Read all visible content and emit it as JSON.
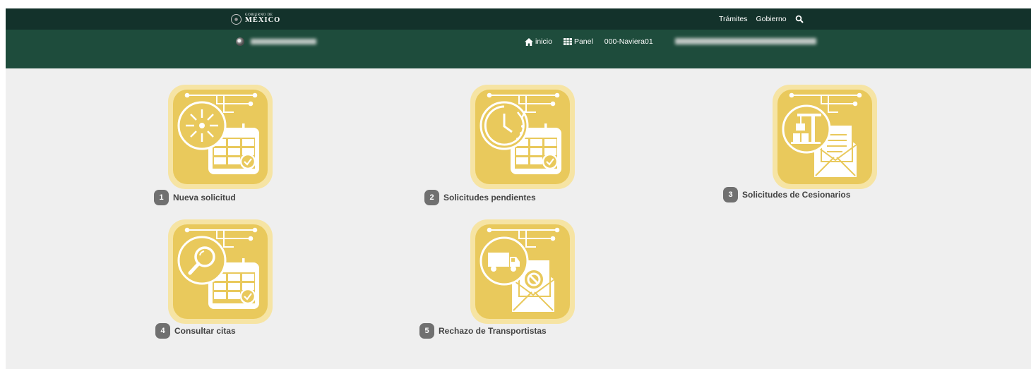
{
  "header": {
    "logo_small": "GOBIERNO DE",
    "logo_big": "MÉXICO",
    "links": [
      "Trámites",
      "Gobierno"
    ],
    "icons": [
      "search-icon",
      "gov-seal-icon"
    ]
  },
  "subheader": {
    "nav": [
      {
        "label": "inicio",
        "icon": "home-icon"
      },
      {
        "label": "Panel",
        "icon": "grid-icon"
      },
      {
        "label": "000-Naviera01",
        "icon": ""
      }
    ]
  },
  "tiles": [
    {
      "number": "1",
      "label": "Nueva solicitud",
      "icon": "new-request-calendar-icon"
    },
    {
      "number": "2",
      "label": "Solicitudes pendientes",
      "icon": "pending-clock-calendar-icon"
    },
    {
      "number": "3",
      "label": "Solicitudes de Cesionarios",
      "icon": "assignee-crane-mail-icon"
    },
    {
      "number": "4",
      "label": "Consultar citas",
      "icon": "search-calendar-icon"
    },
    {
      "number": "5",
      "label": "Rechazo de Transportistas",
      "icon": "truck-reject-mail-icon"
    }
  ],
  "colors": {
    "top_bar": "#13322b",
    "sub_bar": "#1e4c3c",
    "tile_bg": "#e9c95c",
    "tile_border": "#f6e4a4",
    "badge": "#707070",
    "page_bg": "#efefef"
  }
}
